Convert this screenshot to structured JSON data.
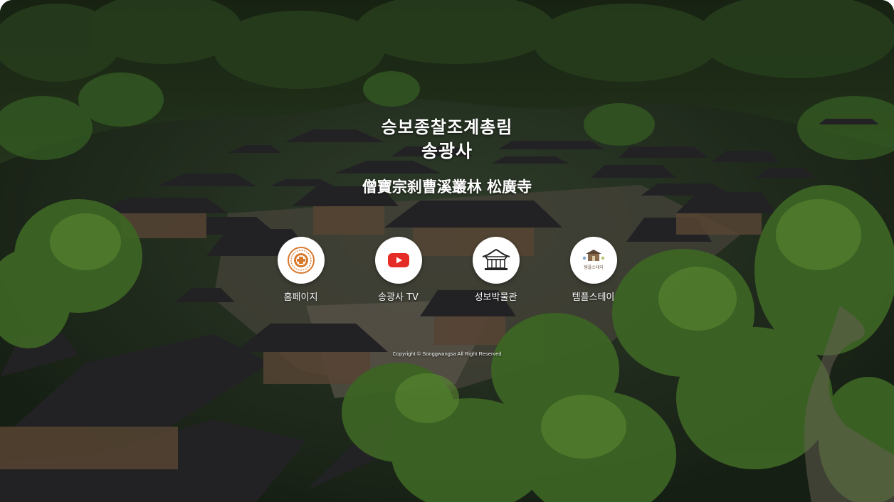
{
  "title": {
    "line1": "승보종찰조계총림",
    "line2": "송광사",
    "hanja": "僧寶宗刹曹溪叢林 松廣寺"
  },
  "links": [
    {
      "label": "홈페이지",
      "icon": "temple-emblem-icon"
    },
    {
      "label": "송광사 TV",
      "icon": "youtube-play-icon"
    },
    {
      "label": "성보박물관",
      "icon": "museum-building-icon"
    },
    {
      "label": "템플스테이",
      "icon": "templestay-logo-icon",
      "icon_text": "템플스테이"
    }
  ],
  "copyright": "Copyright © Songgwangsa All Right Reserved",
  "colors": {
    "youtube_red": "#e52d27",
    "emblem_orange": "#d87a2e",
    "forest_dark": "#1f2a1c",
    "forest_light": "#4f8a2f",
    "roof": "#2b2b2e"
  }
}
